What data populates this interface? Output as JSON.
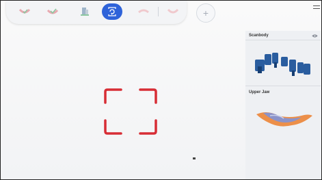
{
  "toolbar": {
    "tools": [
      {
        "icon": "lower-jaw-check-icon",
        "active": false
      },
      {
        "icon": "upper-jaw-check-icon",
        "active": false
      },
      {
        "icon": "scan-body-icon",
        "active": false
      },
      {
        "icon": "rotate-scan-icon",
        "active": true
      },
      {
        "icon": "upper-jaw-icon",
        "active": false
      },
      {
        "icon": "lower-jaw-icon",
        "active": false
      }
    ],
    "add_label": "+"
  },
  "panel": {
    "items": [
      {
        "title": "Scanbody",
        "visibility_icon": "eye-icon"
      },
      {
        "title": "Upper Jaw"
      }
    ]
  },
  "colors": {
    "accent": "#2f63d9",
    "focus_frame": "#d72d35",
    "scanbody": "#2a5d9f"
  }
}
